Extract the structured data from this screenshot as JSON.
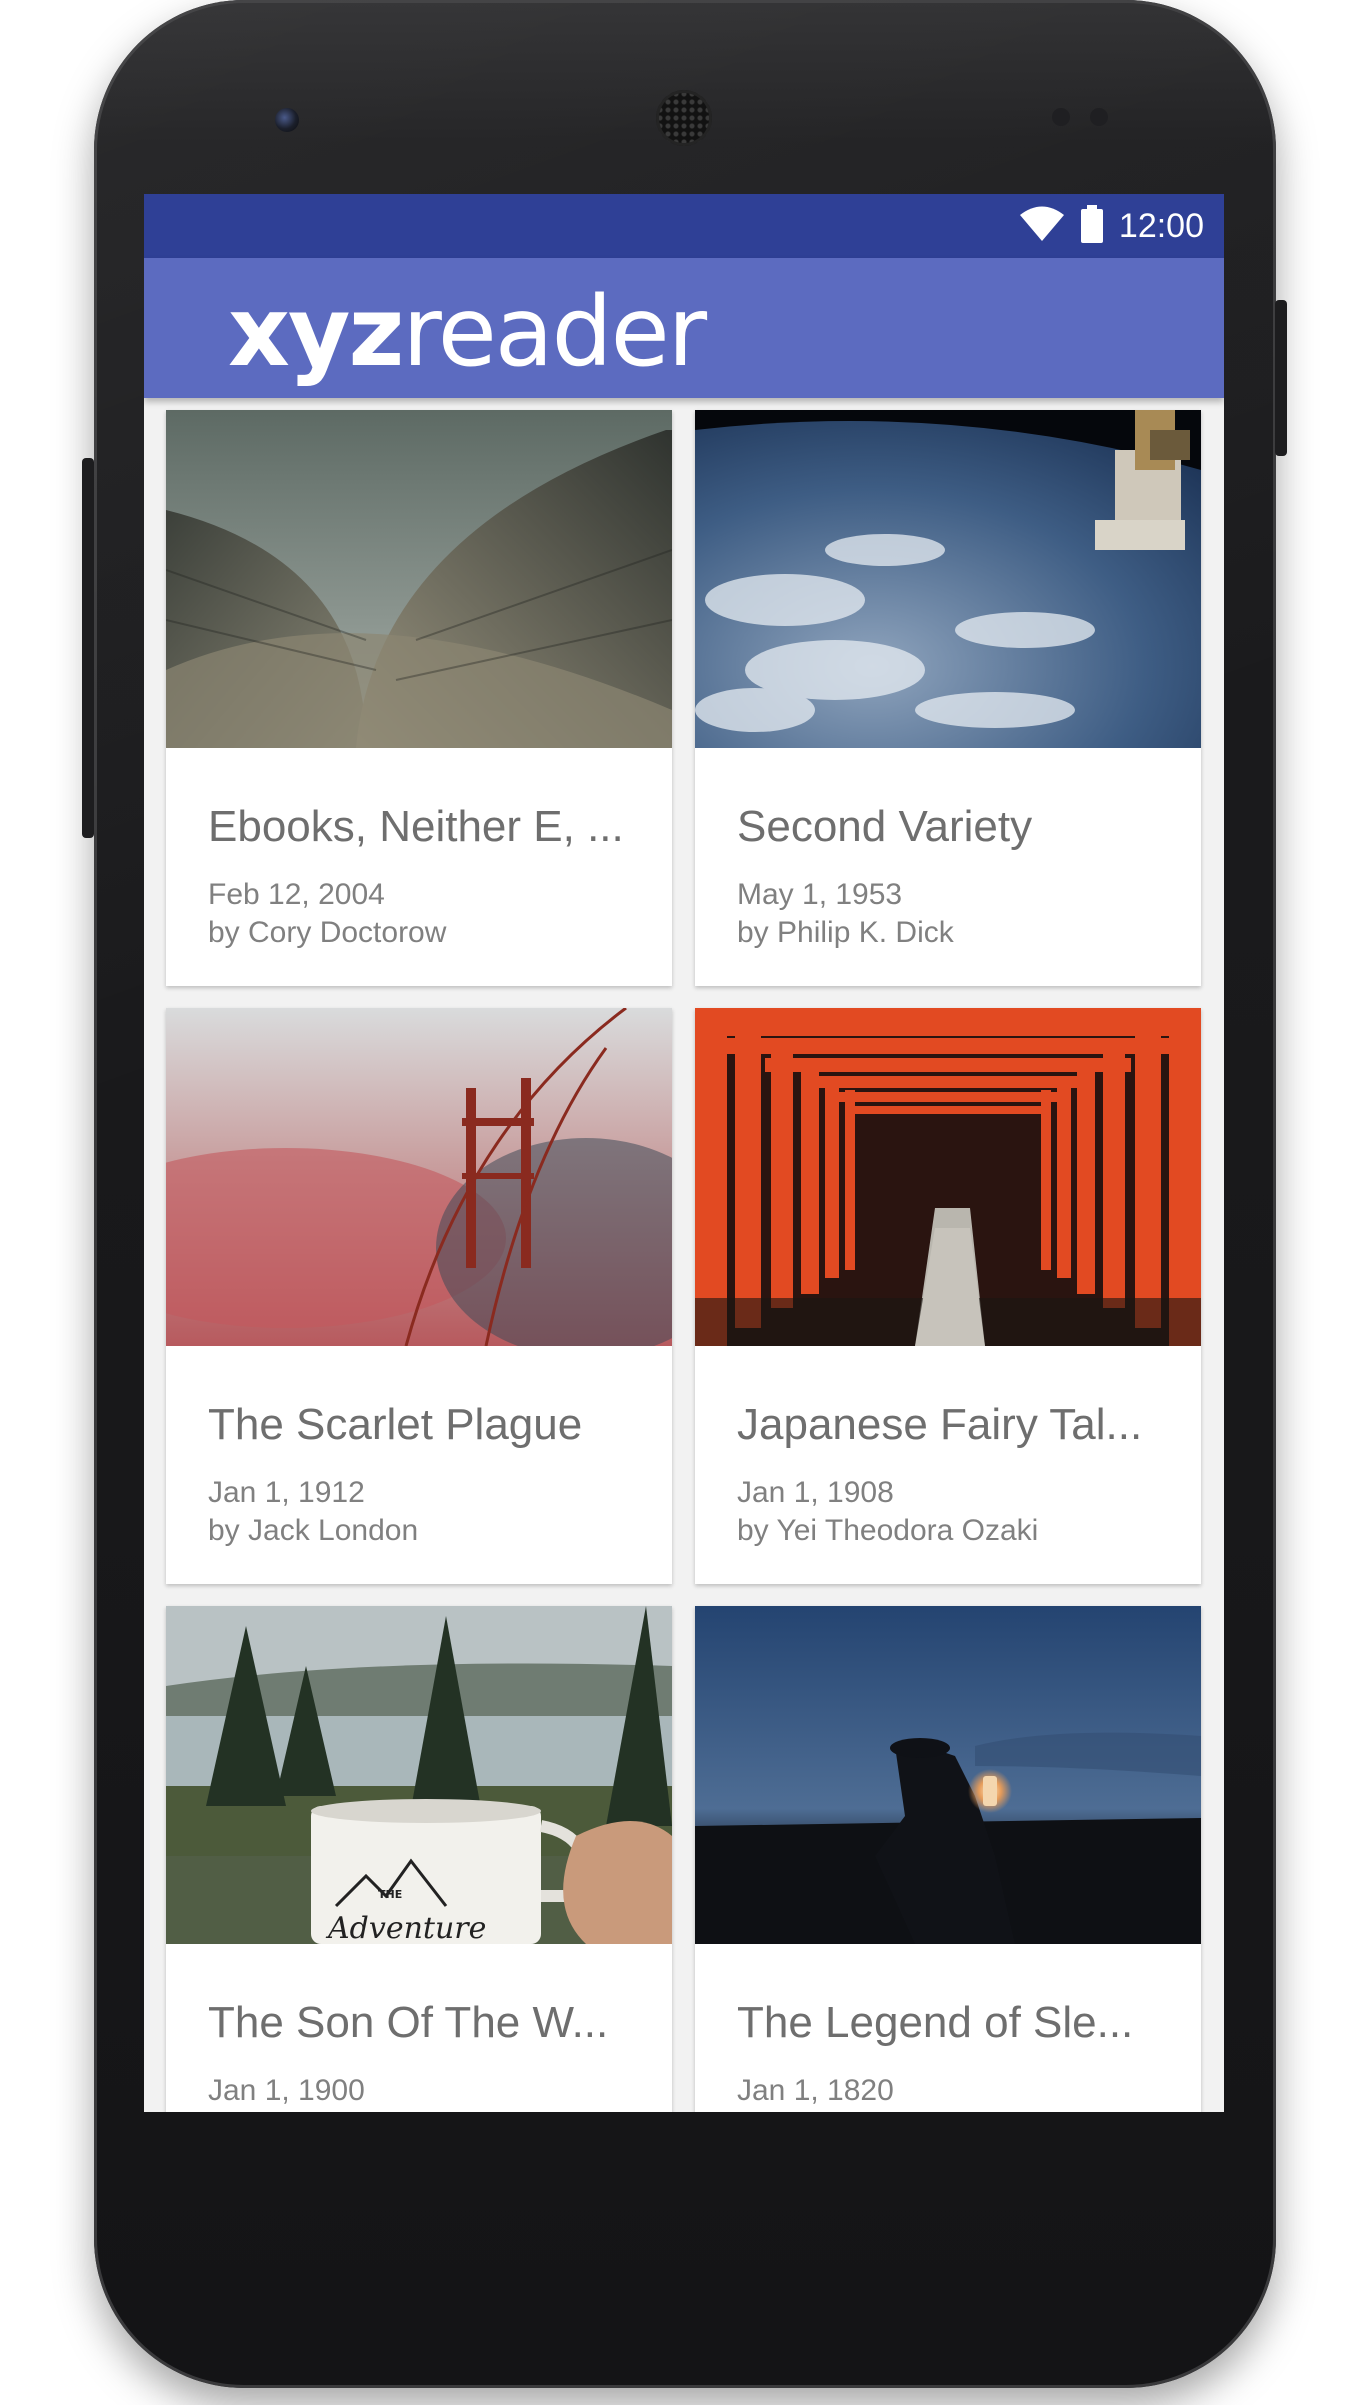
{
  "status_bar": {
    "time": "12:00",
    "icons": [
      "wifi-icon",
      "battery-icon"
    ]
  },
  "app_bar": {
    "logo_bold": "xyz",
    "logo_light": "reader",
    "color": "#5c6bc0",
    "status_color": "#2f4096"
  },
  "articles": [
    {
      "title": "Ebooks, Neither E, ...",
      "date": "Feb 12, 2004",
      "author": "by Cory Doctorow",
      "image": "opera-house-roof"
    },
    {
      "title": "Second Variety",
      "date": "May 1, 1953",
      "author": "by Philip K. Dick",
      "image": "earth-from-space-station"
    },
    {
      "title": "The Scarlet Plague",
      "date": "Jan 1, 1912",
      "author": "by Jack London",
      "image": "bridge-in-red-fog"
    },
    {
      "title": "Japanese Fairy Tal...",
      "date": "Jan 1, 1908",
      "author": "by Yei Theodora Ozaki",
      "image": "torii-gate-tunnel"
    },
    {
      "title": "The Son Of The W...",
      "date": "Jan 1, 1900",
      "author": "",
      "image": "lake-with-enamel-mug",
      "mug_text_1": "THE",
      "mug_text_2": "Adventure"
    },
    {
      "title": "The Legend of Sle...",
      "date": "Jan 1, 1820",
      "author": "",
      "image": "horseman-with-lantern"
    }
  ]
}
